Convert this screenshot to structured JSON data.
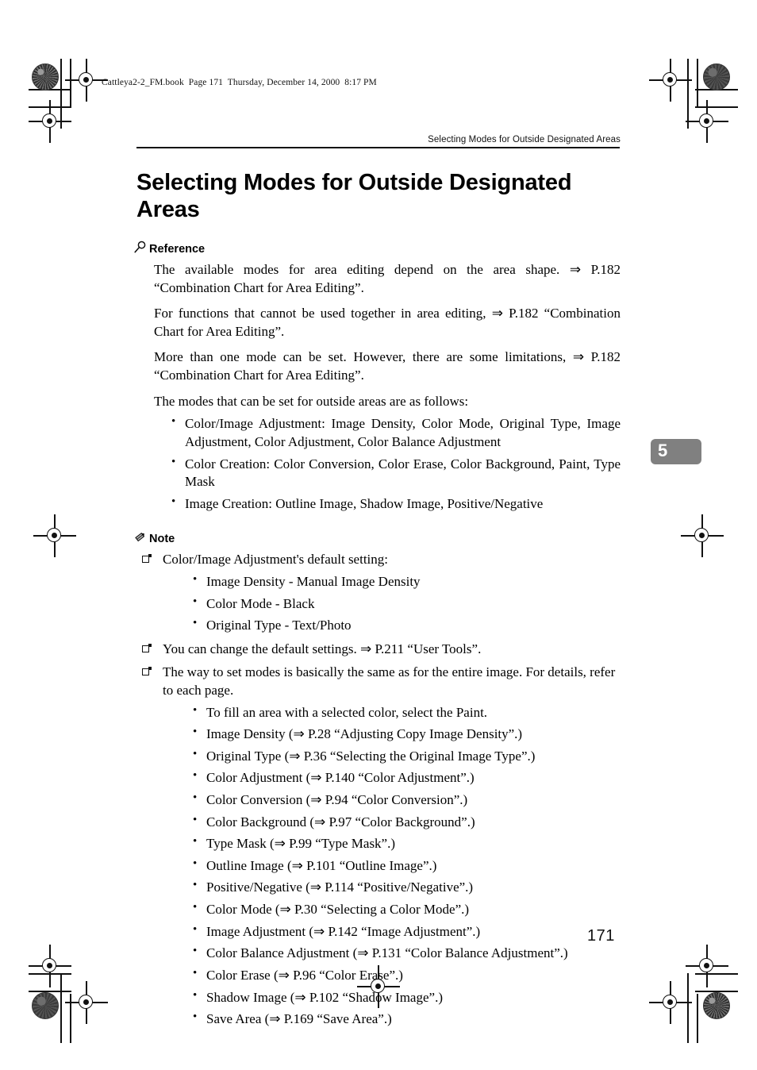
{
  "file_banner": "Cattleya2-2_FM.book  Page 171  Thursday, December 14, 2000  8:17 PM",
  "running_head": "Selecting Modes for Outside Designated Areas",
  "title": "Selecting Modes for Outside Designated Areas",
  "chapter_tab": "5",
  "page_number": "171",
  "reference": {
    "icon": "magnifier-icon",
    "heading": "Reference",
    "paragraphs": [
      "The available modes for area editing depend on the area shape. ⇒ P.182 “Combination Chart for Area Editing”.",
      "For functions that cannot be used together in area editing, ⇒ P.182 “Combination Chart for Area Editing”.",
      "More than one mode can be set. However, there are some limitations, ⇒ P.182 “Combination Chart for Area Editing”.",
      "The modes that can be set for outside areas are as follows:"
    ],
    "bullets": [
      "Color/Image Adjustment: Image Density, Color Mode, Original Type, Image Adjustment, Color Adjustment, Color Balance Adjustment",
      "Color Creation: Color Conversion, Color Erase, Color Background, Paint, Type Mask",
      "Image Creation: Outline Image, Shadow Image, Positive/Negative"
    ]
  },
  "note": {
    "icon": "pencil-icon",
    "heading": "Note",
    "items": [
      {
        "text": "Color/Image Adjustment's default setting:",
        "subbullets": [
          "Image Density - Manual Image Density",
          "Color Mode - Black",
          "Original Type - Text/Photo"
        ]
      },
      {
        "text": "You can change the default settings. ⇒ P.211 “User Tools”.",
        "subbullets": []
      },
      {
        "text": "The way to set modes is basically the same as for the entire image. For details, refer to each page.",
        "subbullets": [
          "To fill an area with a selected color, select the Paint.",
          "Image Density (⇒ P.28 “Adjusting Copy Image Density”.)",
          "Original Type (⇒ P.36 “Selecting the Original Image Type”.)",
          "Color Adjustment (⇒ P.140 “Color Adjustment”.)",
          "Color Conversion (⇒ P.94 “Color Conversion”.)",
          "Color Background (⇒ P.97 “Color Background”.)",
          "Type Mask (⇒ P.99 “Type Mask”.)",
          "Outline Image (⇒ P.101 “Outline Image”.)",
          "Positive/Negative (⇒ P.114 “Positive/Negative”.)",
          "Color Mode (⇒ P.30 “Selecting a Color Mode”.)",
          "Image Adjustment (⇒ P.142 “Image Adjustment”.)",
          "Color Balance Adjustment (⇒ P.131 “Color Balance Adjustment”.)",
          "Color Erase (⇒ P.96 “Color Erase”.)",
          "Shadow Image (⇒ P.102 “Shadow Image”.)",
          "Save Area (⇒ P.169 “Save Area”.)"
        ]
      }
    ]
  },
  "colors": {
    "chapter_tab_bg": "#808080",
    "chapter_tab_text": "#ffffff",
    "ink": "#111111",
    "paper": "#ffffff"
  }
}
